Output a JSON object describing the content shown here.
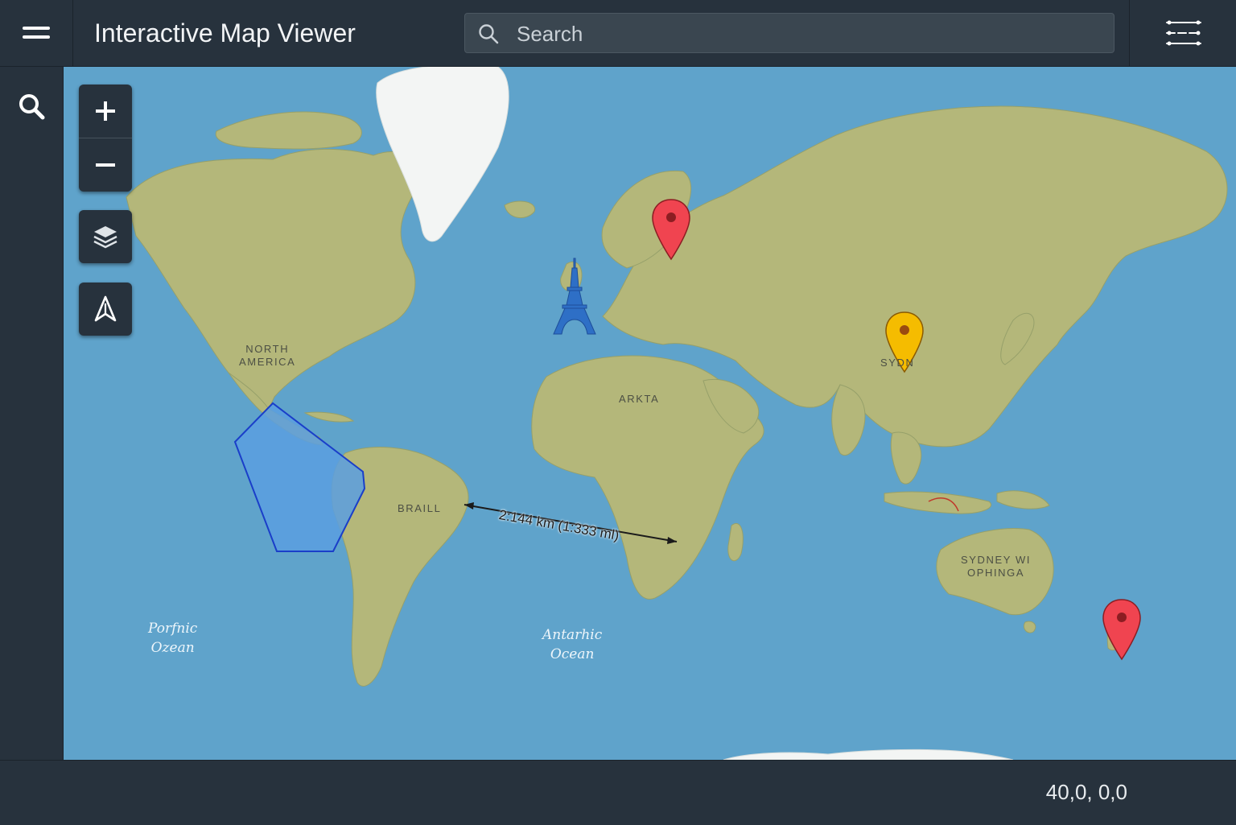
{
  "header": {
    "title": "Interactive Map Viewer",
    "menu_icon": "hamburger-menu-icon",
    "settings_icon": "sliders-settings-icon"
  },
  "search": {
    "placeholder": "Search",
    "value": "",
    "icon": "search-icon"
  },
  "sidebar": {
    "items": [
      {
        "icon": "search-icon"
      }
    ]
  },
  "map_controls": {
    "zoom_in_icon": "plus-icon",
    "zoom_out_icon": "minus-icon",
    "layers_icon": "layers-icon",
    "navigate_icon": "north-arrow-icon"
  },
  "map": {
    "labels": [
      {
        "text": "NORTH\nAMERICA"
      },
      {
        "text": "ARKTA"
      },
      {
        "text": "BRAILL"
      },
      {
        "text": "SYDNEY  WI\nOPHINGA"
      },
      {
        "text": "SYDN"
      }
    ],
    "ocean_labels": [
      {
        "text": "Porfnic\nOzean"
      },
      {
        "text": "Antarhic\nOcean"
      }
    ],
    "measurement": {
      "label": "2:144 km (1:333 ml)"
    },
    "markers": [
      {
        "type": "pin",
        "color": "#f04450"
      },
      {
        "type": "pin",
        "color": "#f5bc00"
      },
      {
        "type": "pin",
        "color": "#f04450"
      },
      {
        "type": "landmark",
        "icon": "eiffel-tower-icon",
        "color": "#2e6fc6"
      }
    ],
    "shapes": [
      {
        "type": "polygon",
        "fill": "#5a9fe0",
        "stroke": "#1a3ec9"
      }
    ]
  },
  "status": {
    "coordinates": "40,0, 0,0"
  },
  "colors": {
    "chrome": "#27323d",
    "ocean": "#5fa3cb",
    "land": "#b4b77a",
    "ice": "#f3f5f4"
  }
}
